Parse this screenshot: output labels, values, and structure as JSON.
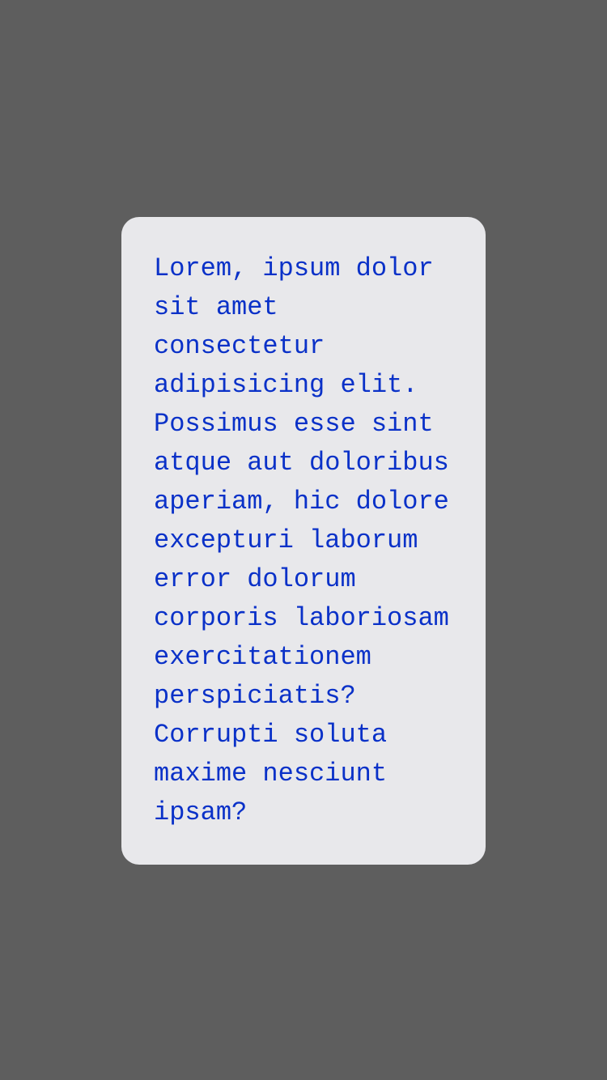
{
  "card": {
    "text": "Lorem, ipsum dolor sit amet consectetur adipisicing elit. Possimus esse sint atque aut doloribus aperiam, hic dolore excepturi laborum error dolorum corporis laboriosam exercitationem perspiciatis? Corrupti soluta maxime nesciunt ipsam?"
  },
  "colors": {
    "background": "#5e5e5e",
    "card": "#e8e8eb",
    "text": "#0a31c8"
  }
}
